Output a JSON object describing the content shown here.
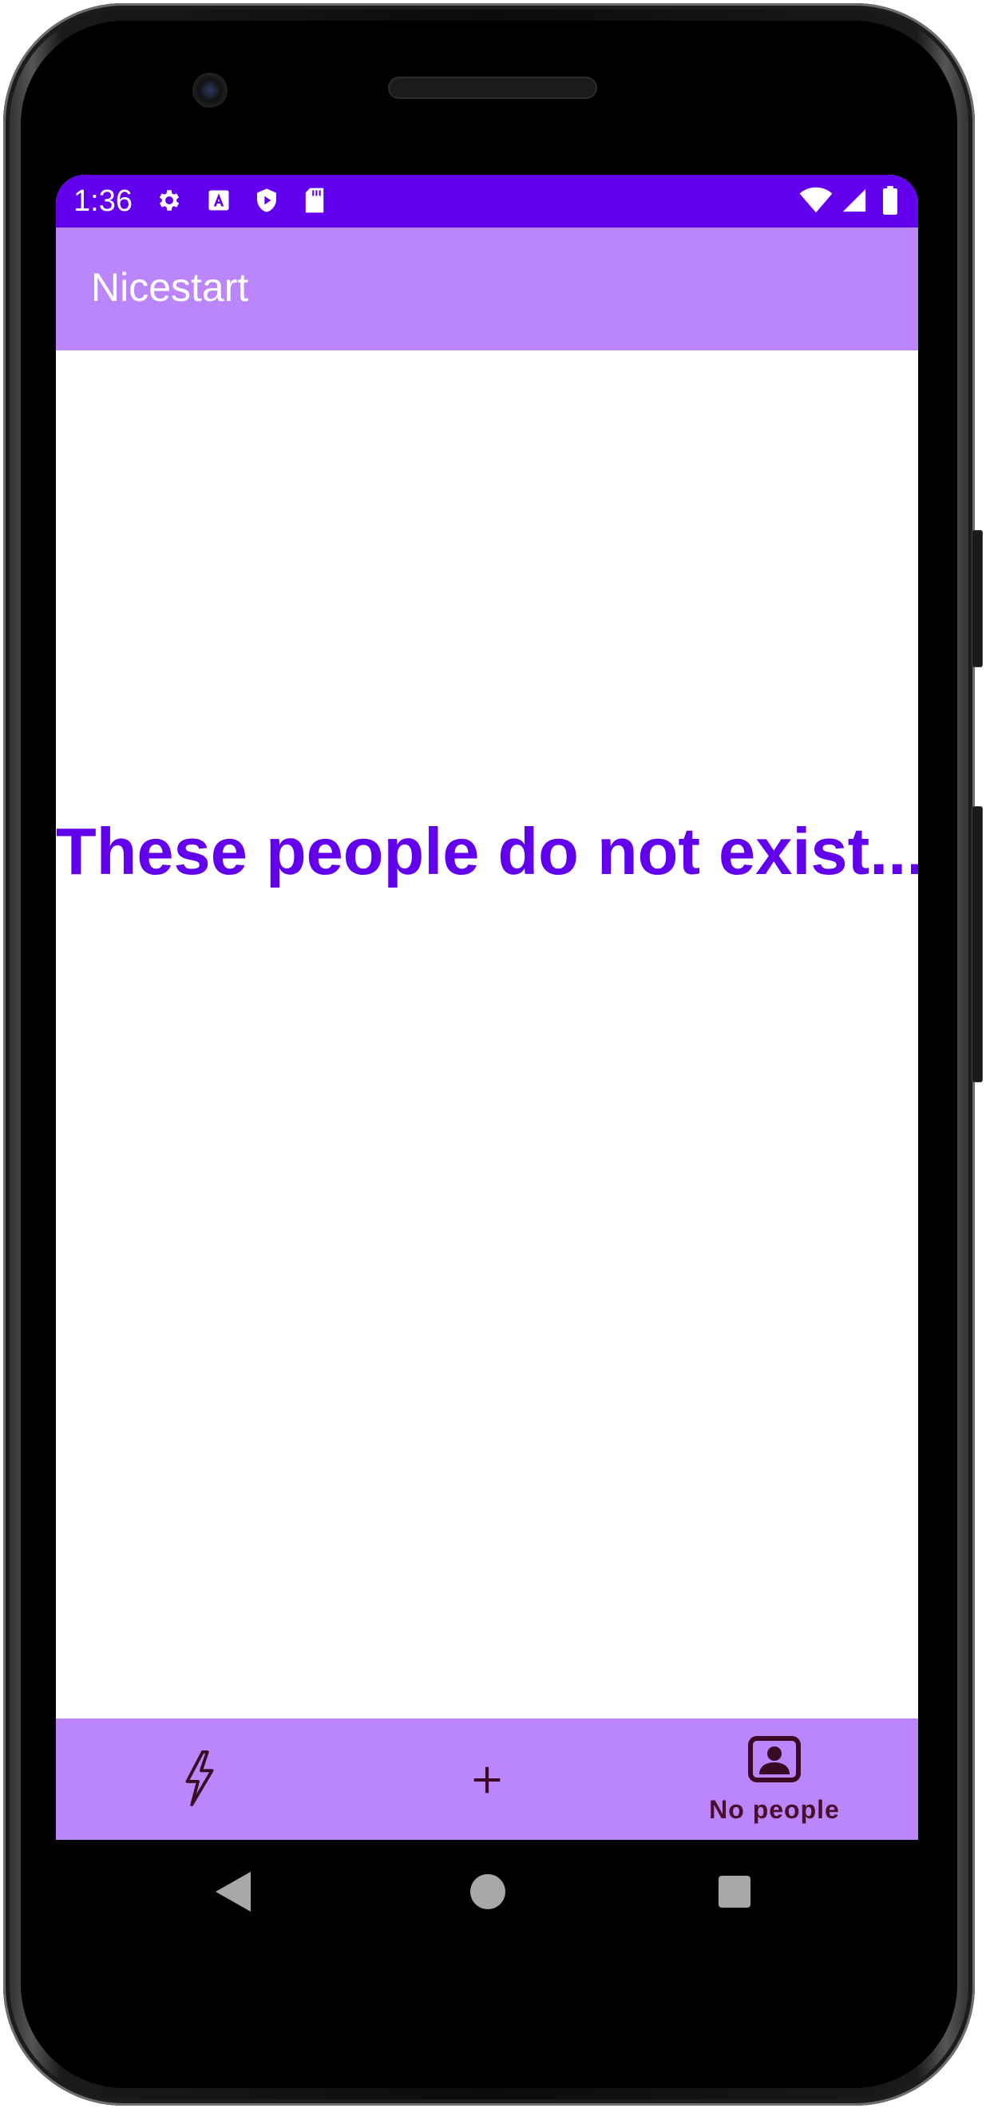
{
  "status_bar": {
    "time": "1:36",
    "color": "#6200ee",
    "icons": [
      "settings-icon",
      "a-icon",
      "shield-icon",
      "sd-card-icon",
      "wifi-icon",
      "signal-icon",
      "battery-icon"
    ]
  },
  "app_bar": {
    "title": "Nicestart",
    "color": "#bb86fc"
  },
  "main": {
    "message": "These people do not exist...",
    "message_color": "#6200ee"
  },
  "bottom_nav": {
    "color": "#bb86fc",
    "items": [
      {
        "icon": "lightning-icon",
        "label": ""
      },
      {
        "icon": "plus-icon",
        "label": ""
      },
      {
        "icon": "person-icon",
        "label": "No people"
      }
    ]
  },
  "system_nav": {
    "buttons": [
      "back-icon",
      "home-icon",
      "recents-icon"
    ]
  }
}
